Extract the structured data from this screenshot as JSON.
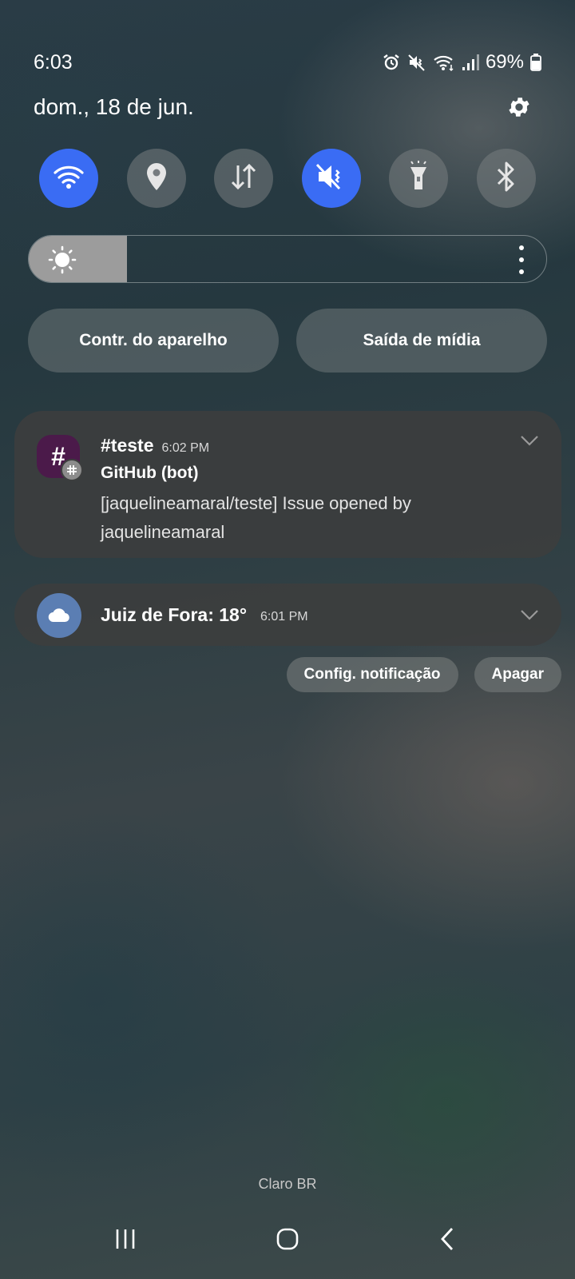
{
  "status_bar": {
    "time": "6:03",
    "battery_percent": "69%",
    "icons": [
      "alarm-icon",
      "mute-icon",
      "wifi-icon",
      "signal-icon",
      "battery-icon"
    ]
  },
  "header": {
    "date": "dom., 18 de jun.",
    "settings_icon": "gear-icon"
  },
  "quick_settings": [
    {
      "name": "wifi",
      "icon": "wifi-icon",
      "active": true
    },
    {
      "name": "location",
      "icon": "location-pin-icon",
      "active": false
    },
    {
      "name": "mobile-data",
      "icon": "data-arrows-icon",
      "active": false
    },
    {
      "name": "sound",
      "icon": "mute-icon",
      "active": true
    },
    {
      "name": "flashlight",
      "icon": "flashlight-icon",
      "active": false
    },
    {
      "name": "bluetooth",
      "icon": "bluetooth-icon",
      "active": false
    }
  ],
  "brightness": {
    "level": 0.19,
    "icon": "sun-icon",
    "menu_icon": "more-vertical-icon"
  },
  "pills": {
    "device_control": "Contr. do aparelho",
    "media_output": "Saída de mídia"
  },
  "notifications": [
    {
      "app_icon": "#",
      "badge_icon": "slack-icon",
      "channel": "#teste",
      "time": "6:02 PM",
      "title": "GitHub (bot)",
      "body": "[jaquelineamaral/teste] Issue opened by jaquelineamaral"
    },
    {
      "app_icon": "cloud-icon",
      "title": "Juiz de Fora: 18°",
      "time": "6:01 PM"
    }
  ],
  "actions": {
    "notification_settings": "Config. notificação",
    "clear": "Apagar"
  },
  "carrier": "Claro BR",
  "nav_bar": {
    "recents": "recents-icon",
    "home": "home-icon",
    "back": "back-icon"
  },
  "colors": {
    "accent": "#3a6cf4",
    "slack_bg": "#4b1a4a",
    "weather_bg": "#5b7eb3"
  }
}
